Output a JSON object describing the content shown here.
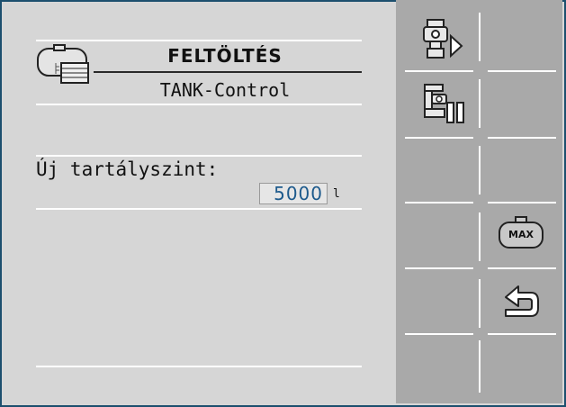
{
  "screen": {
    "title": "FELTÖLTÉS",
    "subtitle": "TANK-Control"
  },
  "field": {
    "label": "Új tartályszint:",
    "value": "5000",
    "unit": "l"
  },
  "softkeys": {
    "max_label": "MAX"
  },
  "colors": {
    "background": "#d6d6d6",
    "softkey_panel": "#a9a9a9",
    "value_text": "#1d5a8c",
    "frame": "#1c4f6e"
  }
}
